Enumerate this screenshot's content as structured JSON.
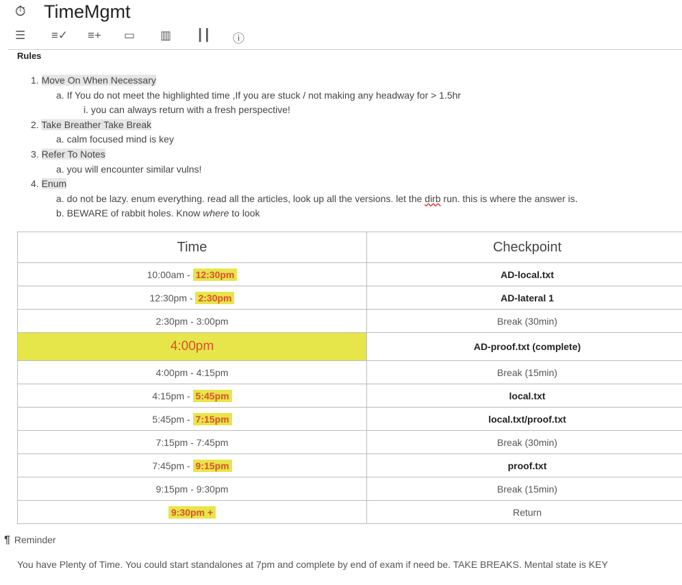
{
  "app": {
    "title": "TimeMgmt",
    "icon": "stopwatch-icon"
  },
  "toolbar": [
    "tune-icon",
    "checklist-icon",
    "playlist-add-icon",
    "layers-icon",
    "map-icon",
    "bar-chart-icon",
    "info-icon"
  ],
  "rules": {
    "heading": "Rules",
    "items": [
      {
        "n": "1.",
        "label": "Move On When Necessary ",
        "subs": [
          {
            "n": "a.",
            "text": "If You do not meet the highlighted time ,If you are stuck / not making any headway for   > 1.5hr"
          },
          {
            "n": "i.",
            "text": "you can always return with a fresh perspective!"
          }
        ]
      },
      {
        "n": "2.",
        "label": "Take Breather Take Break",
        "subs": [
          {
            "n": "a.",
            "text": "calm focused mind is key"
          }
        ]
      },
      {
        "n": "3.",
        "label": "Refer To Notes",
        "subs": [
          {
            "n": "a.",
            "text": "you will encounter similar vulns!"
          }
        ]
      },
      {
        "n": "4.",
        "label": "Enum",
        "subs": [
          {
            "n": "a.",
            "text_pre": "do not be lazy. enum everything. read all the articles, look up all the versions. let the ",
            "misspelled": "dirb",
            "text_post": " run. this is where the answer is."
          },
          {
            "n": "b.",
            "text_pre": "BEWARE of rabbit holes. Know ",
            "em": "where",
            "text_post": " to look"
          }
        ]
      }
    ]
  },
  "table": {
    "headers": [
      "Time",
      "Checkpoint"
    ],
    "rows": [
      {
        "start": "10:00am - ",
        "end": "12:30pm",
        "checkpoint": "AD-local.txt"
      },
      {
        "start": "12:30pm  - ",
        "end": "2:30pm",
        "checkpoint": "AD-lateral 1"
      },
      {
        "start": "2:30pm  - 3:00pm",
        "end": "",
        "checkpoint": "Break (30min)"
      },
      {
        "start": "4:00pm",
        "end": "",
        "checkpoint": "AD-proof.txt (complete)"
      },
      {
        "start": "4:00pm  - 4:15pm",
        "end": "",
        "checkpoint": "Break (15min)"
      },
      {
        "start": "4:15pm - ",
        "end": "5:45pm",
        "checkpoint": "local.txt"
      },
      {
        "start": "5:45pm  - ",
        "end": "7:15pm",
        "checkpoint": "local.txt/proof.txt"
      },
      {
        "start": "7:15pm  - 7:45pm",
        "end": "",
        "checkpoint": "Break (30min)"
      },
      {
        "start": "7:45pm - ",
        "end": "9:15pm",
        "checkpoint": "proof.txt"
      },
      {
        "start": "9:15pm  - 9:30pm",
        "end": "",
        "checkpoint": "Break (15min)"
      },
      {
        "start": "",
        "end": "9:30pm +  ",
        "checkpoint": "Return"
      }
    ]
  },
  "reminder": {
    "icon": "¶",
    "heading": "Reminder",
    "text": "You have Plenty of Time. You could start standalones at 7pm and complete by end of exam if need be. TAKE BREAKS. Mental state is KEY"
  },
  "colors": {
    "highlight": "#e6e64a",
    "highlight_text": "#e04e2e"
  }
}
